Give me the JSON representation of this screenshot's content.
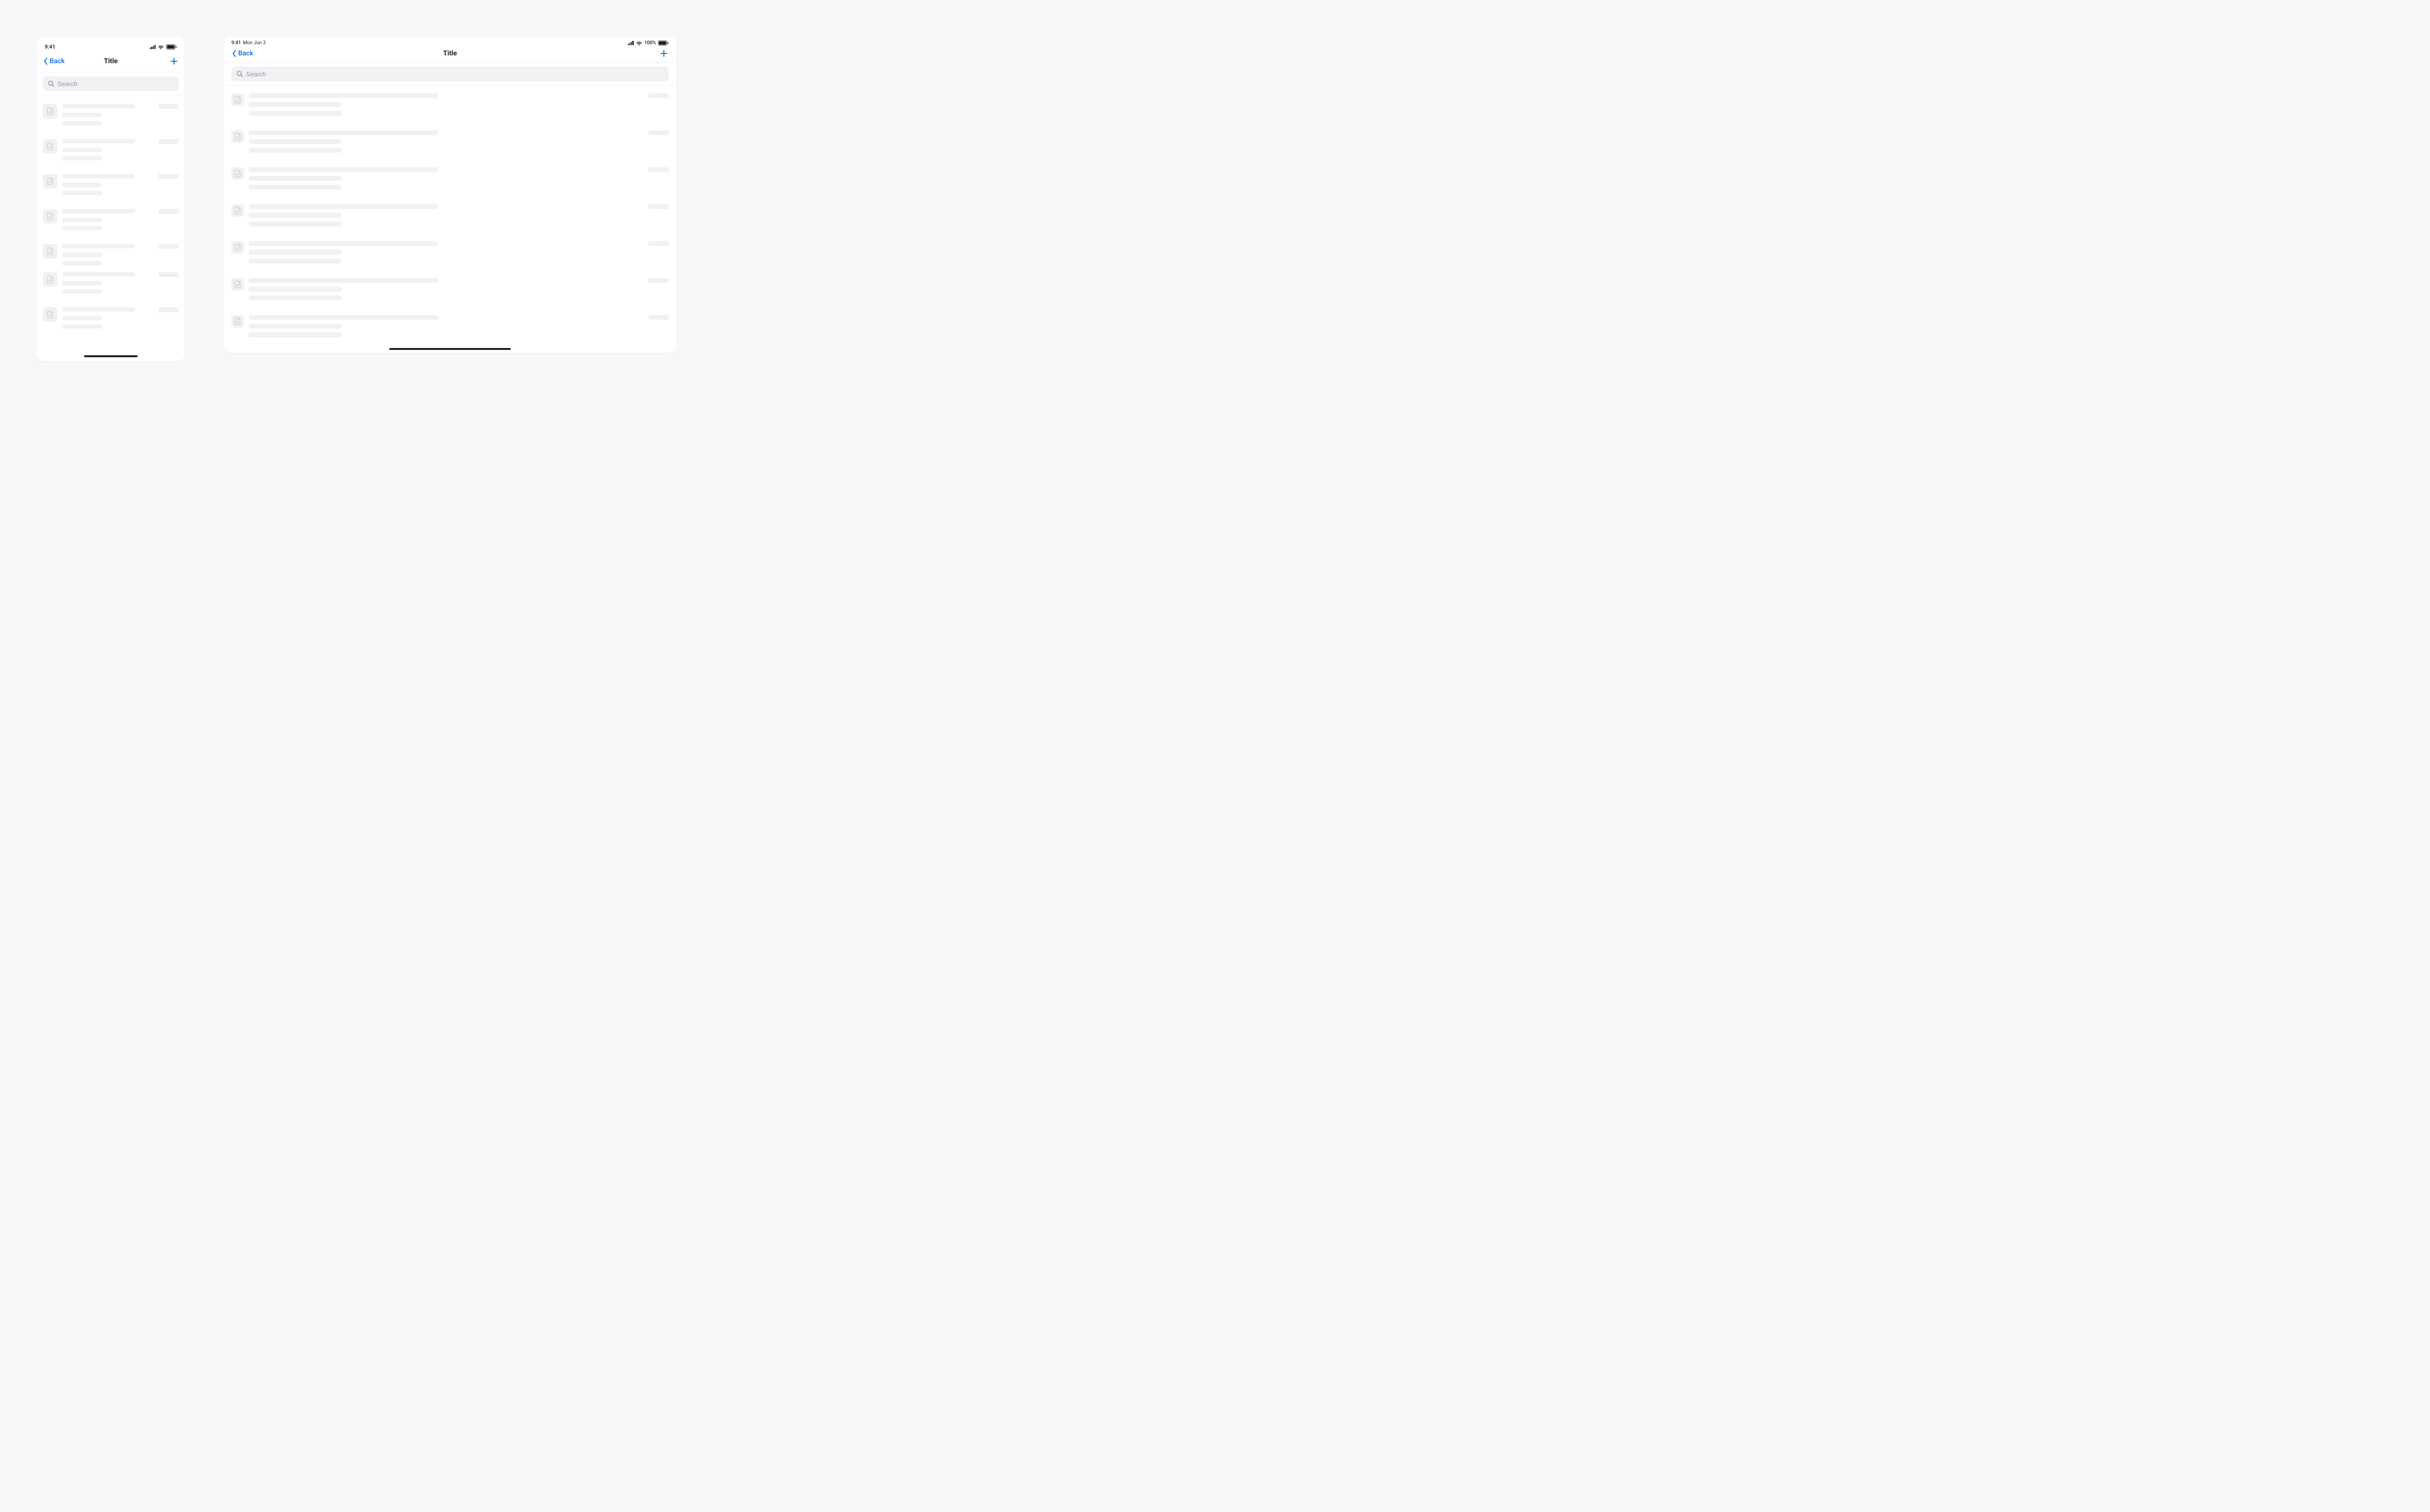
{
  "phone": {
    "status": {
      "time": "9:41"
    },
    "nav": {
      "back": "Back",
      "title": "Title"
    },
    "search": {
      "placeholder": "Search"
    }
  },
  "tablet": {
    "status": {
      "time": "9:41",
      "date": "Mon Jun 3",
      "battery": "100%"
    },
    "nav": {
      "back": "Back",
      "title": "Title"
    },
    "search": {
      "placeholder": "Search"
    }
  },
  "row_count_phone": 7,
  "row_count_tablet": 7
}
